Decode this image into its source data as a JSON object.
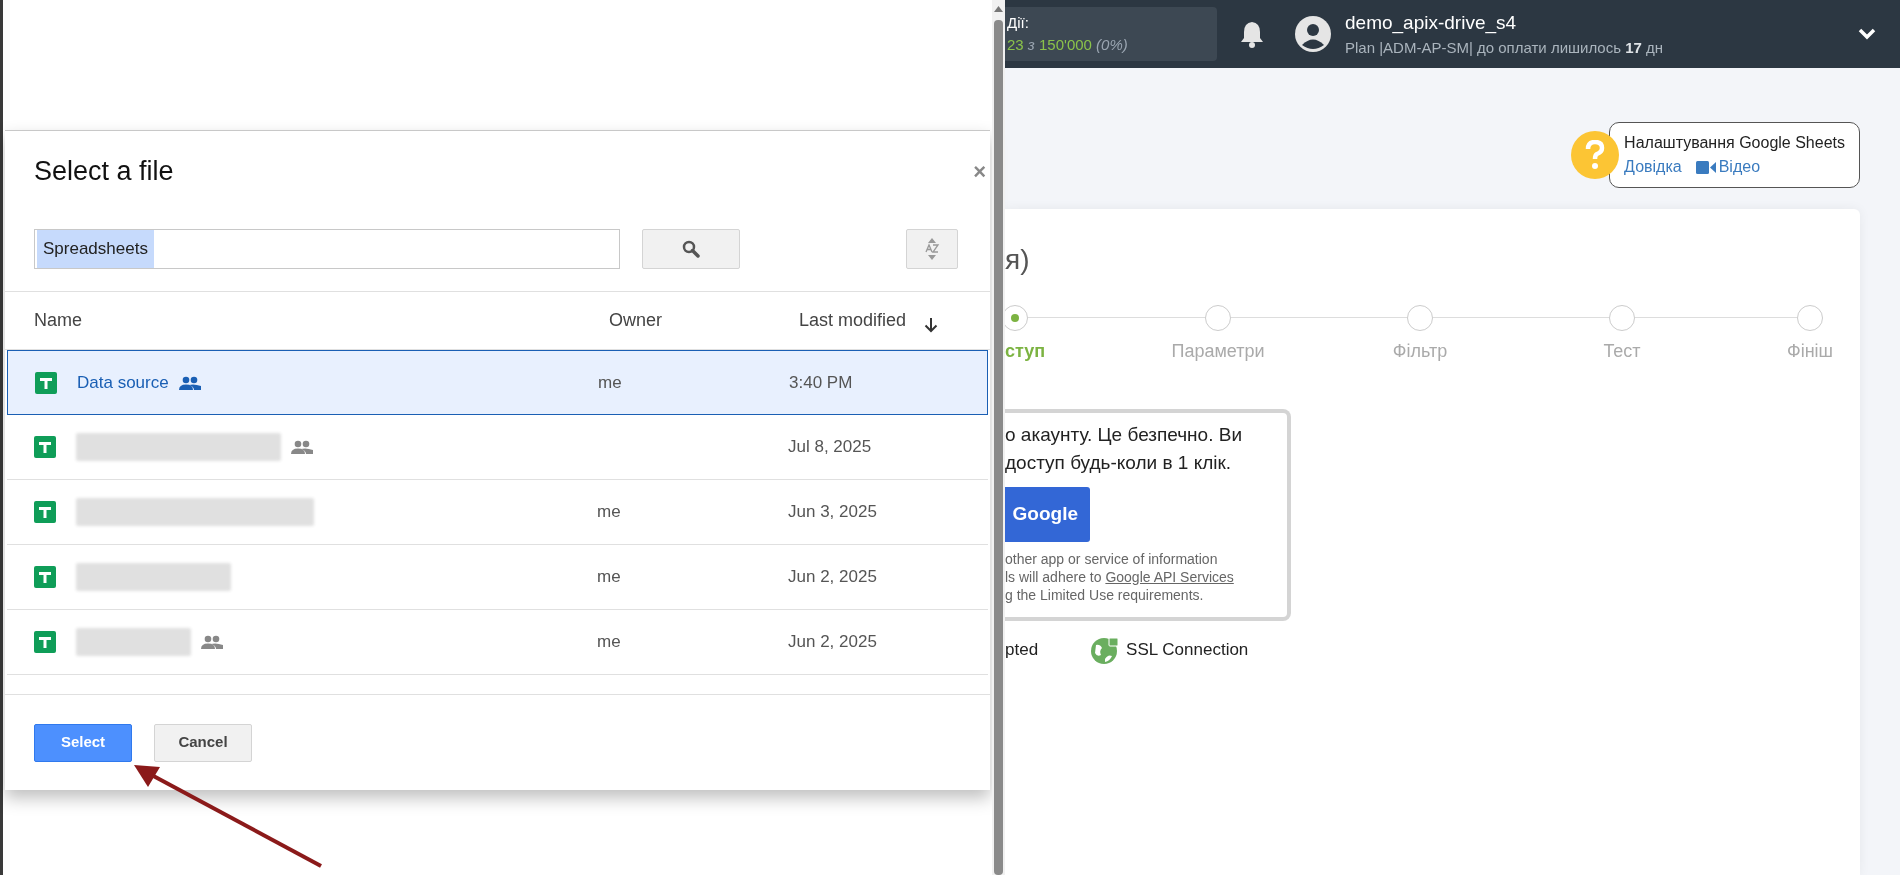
{
  "dialog": {
    "title": "Select a file",
    "close": "×",
    "search": {
      "value": "Spreadsheets"
    },
    "columns": [
      "Name",
      "Owner",
      "Last modified"
    ],
    "rows": [
      {
        "name": "Data source",
        "shared": true,
        "owner": "me",
        "modified": "3:40 PM",
        "selected": true
      },
      {
        "shared": true,
        "modified": "Jul 8, 2025",
        "selected": false
      },
      {
        "shared": false,
        "owner": "me",
        "modified": "Jun 3, 2025",
        "selected": false
      },
      {
        "shared": false,
        "owner": "me",
        "modified": "Jun 2, 2025",
        "selected": false
      },
      {
        "shared": true,
        "owner": "me",
        "modified": "Jun 2, 2025",
        "selected": false
      }
    ],
    "buttons": [
      {
        "label": "Select",
        "kind": "primary"
      },
      {
        "label": "Cancel",
        "kind": "secondary"
      }
    ]
  },
  "topbar": {
    "actions_label": "Дії:",
    "actions_used": "23",
    "actions_sep": "з",
    "actions_total": "150'000",
    "actions_pct": "(0%)",
    "user": "demo_apix-drive_s4",
    "plan": "Plan |ADM-AP-SM| до оплати лишилось",
    "days": "17",
    "days_unit": "дн"
  },
  "help": {
    "title": "Налаштування Google Sheets",
    "link": "Довідка",
    "video": "Відео"
  },
  "card": {
    "title": "я)",
    "steps": [
      {
        "label": "ступ",
        "selected": true
      },
      {
        "label": "Параметри",
        "selected": false
      },
      {
        "label": "Фільтр",
        "selected": false
      },
      {
        "label": "Тест",
        "selected": false
      },
      {
        "label": "Фініш",
        "selected": false
      }
    ],
    "info_lines": [
      "о акаунту. Це безпечно. Ви",
      "доступ будь-коли в 1 клік."
    ],
    "google_button": "Google",
    "note_lines": [
      "other app or service of information",
      "ls will adhere to"
    ],
    "note_link": "Google API Services",
    "note_last": "g the Limited Use requirements.",
    "badges": [
      "pted",
      "SSL Connection"
    ]
  }
}
